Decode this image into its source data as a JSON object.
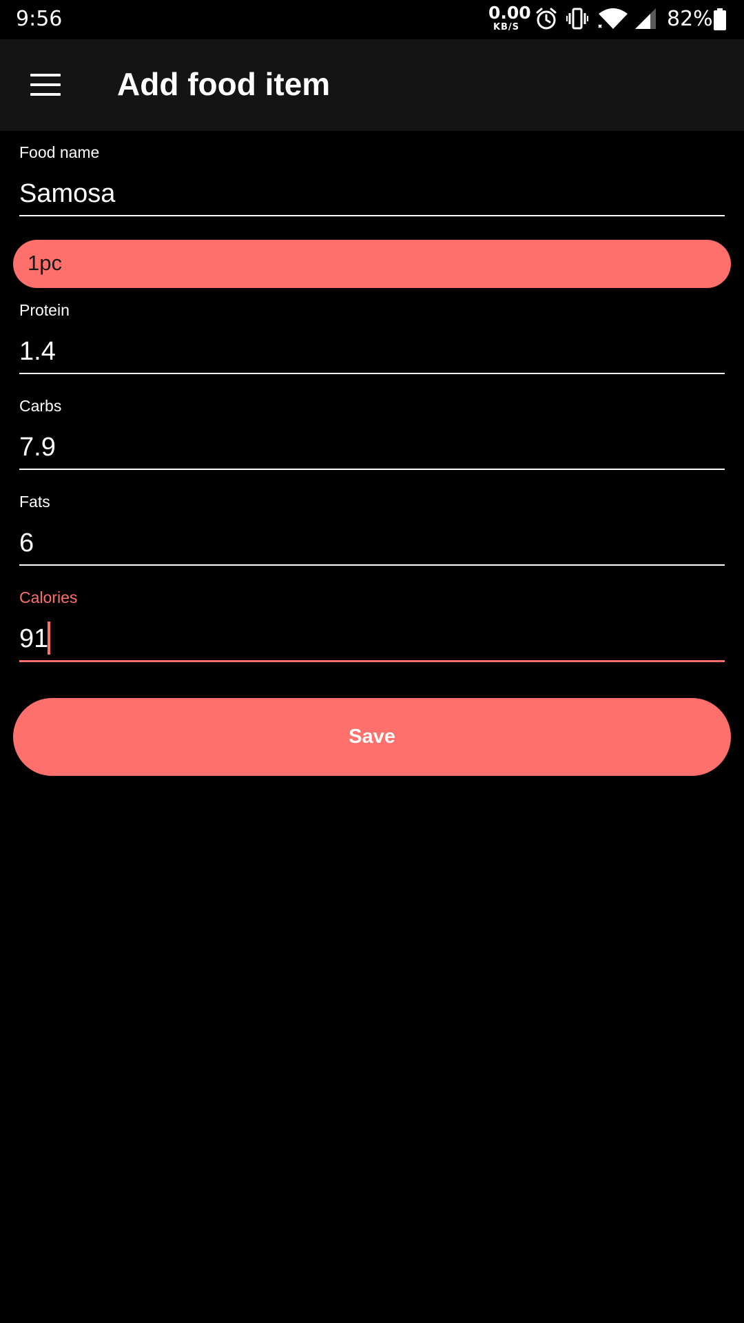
{
  "status_bar": {
    "time": "9:56",
    "net_speed_value": "0.00",
    "net_speed_unit": "KB/S",
    "battery": "82%",
    "icons": [
      "alarm-icon",
      "vibrate-icon",
      "wifi-icon",
      "cell-signal-icon",
      "battery-icon"
    ]
  },
  "app_bar": {
    "title": "Add food item",
    "menu_icon": "hamburger-menu-icon"
  },
  "form": {
    "food_name": {
      "label": "Food name",
      "value": "Samosa"
    },
    "unit": {
      "value": "1pc"
    },
    "protein": {
      "label": "Protein",
      "value": "1.4"
    },
    "carbs": {
      "label": "Carbs",
      "value": "7.9"
    },
    "fats": {
      "label": "Fats",
      "value": "6"
    },
    "calories": {
      "label": "Calories",
      "value": "91"
    }
  },
  "save_label": "Save",
  "colors": {
    "accent": "#ff6f6b",
    "background": "#000000",
    "app_bar": "#141414",
    "text": "#ffffff"
  }
}
